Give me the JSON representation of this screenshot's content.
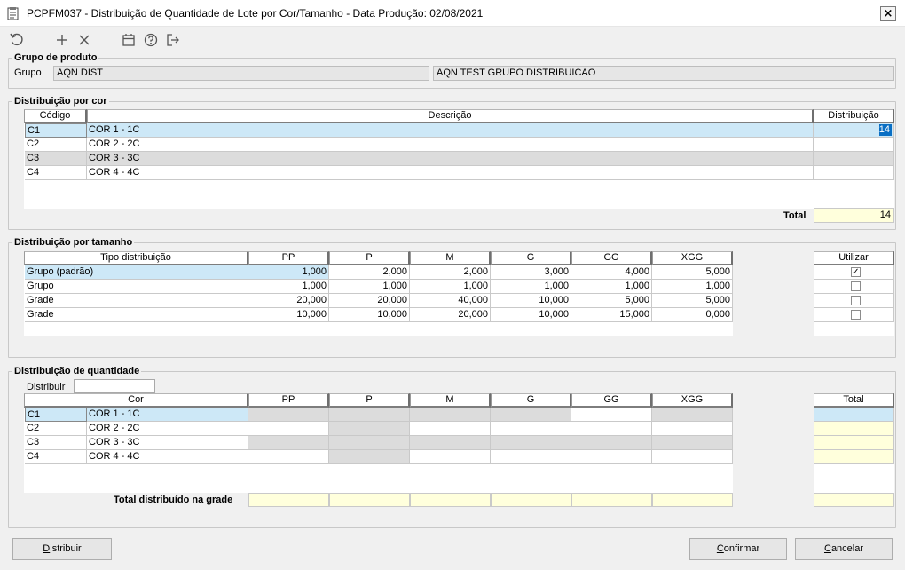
{
  "window": {
    "title": "PCPFM037 - Distribuição de Quantidade de Lote por Cor/Tamanho - Data Produção: 02/08/2021",
    "close_label": "×"
  },
  "toolbar": {
    "icons": [
      "refresh-icon",
      "add-icon",
      "delete-icon",
      "calendar-icon",
      "help-icon",
      "exit-icon"
    ]
  },
  "grupo_produto": {
    "title": "Grupo de produto",
    "label": "Grupo",
    "code": "AQN DIST",
    "description": "AQN TEST GRUPO DISTRIBUICAO"
  },
  "dist_cor": {
    "title": "Distribuição por cor",
    "headers": [
      "Código",
      "Descrição",
      "Distribuição"
    ],
    "rows": [
      {
        "codigo": "C1",
        "descricao": "COR 1 - 1C",
        "distribuicao": "14"
      },
      {
        "codigo": "C2",
        "descricao": "COR 2 - 2C",
        "distribuicao": ""
      },
      {
        "codigo": "C3",
        "descricao": "COR 3 - 3C",
        "distribuicao": ""
      },
      {
        "codigo": "C4",
        "descricao": "COR 4 - 4C",
        "distribuicao": ""
      }
    ],
    "total_label": "Total",
    "total_value": "14"
  },
  "dist_tamanho": {
    "title": "Distribuição por tamanho",
    "headers": [
      "Tipo distribuição",
      "PP",
      "P",
      "M",
      "G",
      "GG",
      "XGG"
    ],
    "utilizar_label": "Utilizar",
    "rows": [
      {
        "tipo": "Grupo (padrão)",
        "values": [
          "1,000",
          "2,000",
          "2,000",
          "3,000",
          "4,000",
          "5,000"
        ],
        "utilizar": true
      },
      {
        "tipo": "Grupo",
        "values": [
          "1,000",
          "1,000",
          "1,000",
          "1,000",
          "1,000",
          "1,000"
        ],
        "utilizar": false
      },
      {
        "tipo": "Grade",
        "values": [
          "20,000",
          "20,000",
          "40,000",
          "10,000",
          "5,000",
          "5,000"
        ],
        "utilizar": false
      },
      {
        "tipo": "Grade",
        "values": [
          "10,000",
          "10,000",
          "20,000",
          "10,000",
          "15,000",
          "0,000"
        ],
        "utilizar": false
      }
    ]
  },
  "dist_quantidade": {
    "title": "Distribuição de quantidade",
    "distribuir_label": "Distribuir",
    "distribuir_value": "",
    "headers": [
      "Cor",
      "PP",
      "P",
      "M",
      "G",
      "GG",
      "XGG"
    ],
    "total_header": "Total",
    "rows": [
      {
        "codigo": "C1",
        "descricao": "COR 1 - 1C"
      },
      {
        "codigo": "C2",
        "descricao": "COR 2 - 2C"
      },
      {
        "codigo": "C3",
        "descricao": "COR 3 - 3C"
      },
      {
        "codigo": "C4",
        "descricao": "COR 4 - 4C"
      }
    ],
    "total_label": "Total distribuído na grade"
  },
  "buttons": {
    "distribuir_first": "D",
    "distribuir_rest": "istribuir",
    "confirmar_first": "C",
    "confirmar_rest": "onfirmar",
    "cancelar_first": "C",
    "cancelar_rest": "ancelar"
  }
}
